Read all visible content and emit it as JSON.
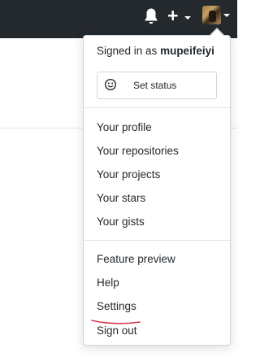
{
  "header": {
    "icons": {
      "notifications": "bell-icon",
      "create": "plus-icon",
      "dropdown": "caret-down-icon"
    },
    "plus_glyph": "+"
  },
  "user_menu": {
    "signed_in_prefix": "Signed in as ",
    "username": "mupeifeiyi",
    "set_status_label": "Set status",
    "set_status_icon": "smiley-icon",
    "items": [
      {
        "label": "Your profile"
      },
      {
        "label": "Your repositories"
      },
      {
        "label": "Your projects"
      },
      {
        "label": "Your stars"
      },
      {
        "label": "Your gists"
      }
    ],
    "items2": [
      {
        "label": "Feature preview"
      },
      {
        "label": "Help"
      },
      {
        "label": "Settings"
      },
      {
        "label": "Sign out"
      }
    ]
  },
  "colors": {
    "header_bg": "#24292e",
    "annotation": "#d73a49"
  }
}
